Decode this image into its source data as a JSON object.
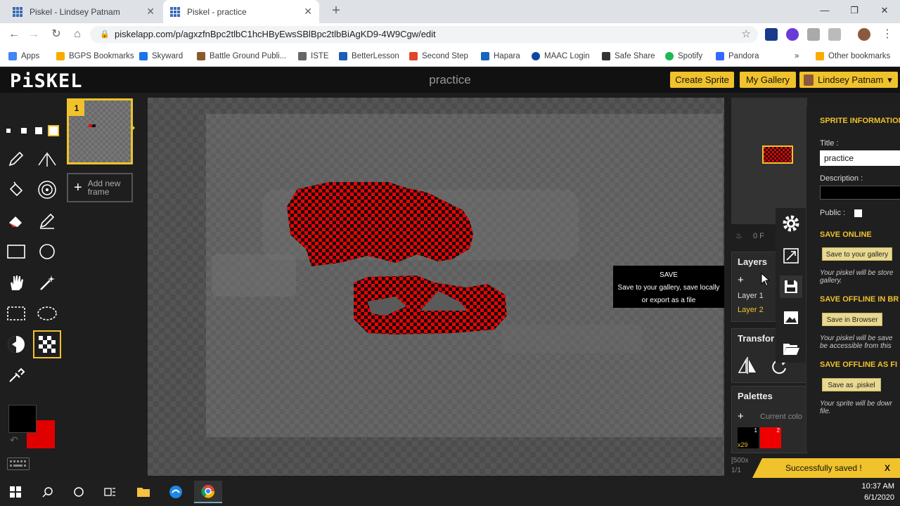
{
  "browser": {
    "tabs": [
      {
        "title": "Piskel - Lindsey Patnam",
        "close": "✕"
      },
      {
        "title": "Piskel - practice",
        "close": "✕"
      }
    ],
    "new_tab": "+",
    "window": {
      "minimize": "—",
      "maximize": "❐",
      "close": "✕"
    },
    "url": "piskelapp.com/p/agxzfnBpc2tlbC1hcHByEwsSBlBpc2tlbBiAgKD9-4W9Cgw/edit",
    "bookmarks": [
      {
        "label": "Apps",
        "color": "#4285f4"
      },
      {
        "label": "BGPS Bookmarks",
        "color": "#f9ab00"
      },
      {
        "label": "Skyward",
        "color": "#1a73e8"
      },
      {
        "label": "Battle Ground Publi...",
        "color": "#8b5a2b"
      },
      {
        "label": "ISTE",
        "color": "#666"
      },
      {
        "label": "BetterLesson",
        "color": "#1a5fb4"
      },
      {
        "label": "Second Step",
        "color": "#e0452b"
      },
      {
        "label": "Hapara",
        "color": "#1565c0"
      },
      {
        "label": "MAAC Login",
        "color": "#0d47a1"
      },
      {
        "label": "Safe Share",
        "color": "#333"
      },
      {
        "label": "Spotify",
        "color": "#1db954"
      },
      {
        "label": "Pandora",
        "color": "#3668ff"
      }
    ],
    "bookmarks_more": "»",
    "other_bookmarks": "Other bookmarks"
  },
  "app": {
    "logo": "PiSKEL",
    "sprite_name": "practice",
    "create_sprite": "Create Sprite",
    "my_gallery": "My Gallery",
    "user": "Lindsey Patnam",
    "user_caret": "▾",
    "frame_number": "1",
    "add_frame_plus": "+",
    "add_frame_label": "Add new frame"
  },
  "save_tooltip": {
    "title": "SAVE",
    "line1": "Save to your gallery, save locally",
    "line2": "or export as a file"
  },
  "right_panel": {
    "fps": "0 F",
    "layers_title": "Layers",
    "add_layer": "+",
    "layers": [
      "Layer 1",
      "Layer 2"
    ],
    "transform_title": "Transfor",
    "palettes_title": "Palettes",
    "palette_add": "+",
    "current_colors": "Current colo",
    "swatch_1": "1",
    "swatch_2": "2",
    "cursor_pos": "x29",
    "canvas_size": "[500x",
    "frame_count": "1/1"
  },
  "drawer": {
    "sprite_info": "SPRITE INFORMATION",
    "title_label": "Title :",
    "title_value": "practice",
    "description_label": "Description :",
    "public_label": "Public :",
    "save_online": "SAVE ONLINE",
    "save_gallery_btn": "Save to your gallery",
    "save_gallery_note1": "Your piskel will be store",
    "save_gallery_note2": "gallery.",
    "save_offline_browser": "SAVE OFFLINE IN BR",
    "save_browser_btn": "Save in Browser",
    "save_browser_note1": "Your piskel will be save",
    "save_browser_note2": "be accessible from this",
    "save_offline_file": "SAVE OFFLINE AS FI",
    "save_piskel_btn": "Save as .piskel",
    "save_piskel_note1": "Your sprite will be dowr",
    "save_piskel_note2": "file."
  },
  "toast": {
    "message": "Successfully saved !",
    "close": "X"
  },
  "taskbar": {
    "time": "10:37 AM",
    "date": "6/1/2020"
  },
  "colors": {
    "accent": "#f0c22c",
    "primary_color": "#000000",
    "secondary_color": "#e00000"
  }
}
